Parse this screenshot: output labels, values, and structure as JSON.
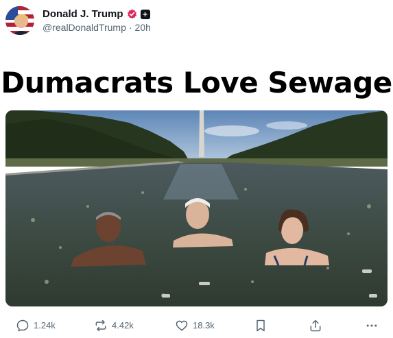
{
  "post": {
    "author": {
      "display_name": "Donald J. Trump",
      "handle": "@realDonaldTrump",
      "time_ago": "20h",
      "separator": "·"
    },
    "plus_badge": "+",
    "headline": "Dumacrats Love Sewage",
    "image_icon": "photo-image"
  },
  "actions": {
    "replies": "1.24k",
    "reposts": "4.42k",
    "likes": "18.3k"
  },
  "colors": {
    "verified": "#e0245e",
    "text_secondary": "#536471"
  }
}
